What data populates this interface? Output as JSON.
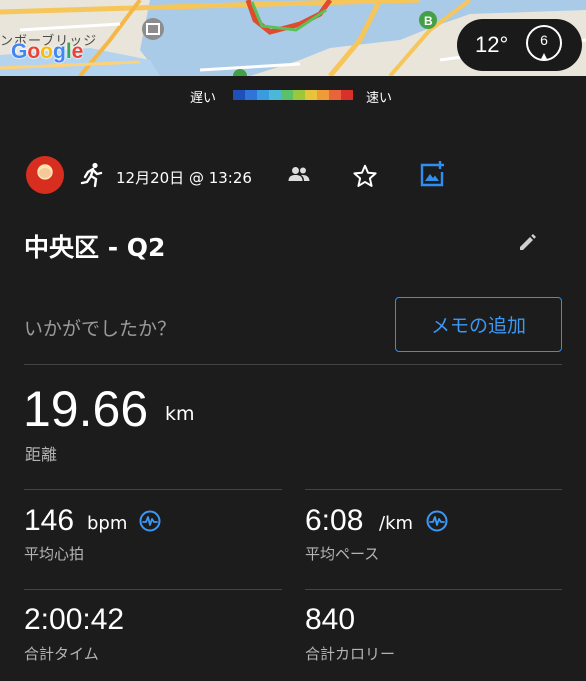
{
  "map": {
    "label": "ンボーブリッジ",
    "google_logo": [
      "G",
      "o",
      "o",
      "g",
      "l",
      "e"
    ],
    "google_colors": [
      "#4285F4",
      "#EA4335",
      "#FBBC05",
      "#4285F4",
      "#34A853",
      "#EA4335"
    ],
    "weather": {
      "temperature": "12°",
      "wind_speed": "6"
    }
  },
  "pace_legend": {
    "slow_label": "遅い",
    "fast_label": "速い",
    "colors": [
      "#1f4fb8",
      "#2f74d6",
      "#3a9be0",
      "#4cb8d8",
      "#5bc06a",
      "#9ac83a",
      "#e9c33a",
      "#f09a3a",
      "#e8643a",
      "#d9302a"
    ]
  },
  "activity": {
    "type_icon": "running-icon",
    "date": "12月20日 @ 13:26",
    "title": "中央区 - Q2"
  },
  "memo": {
    "prompt": "いかがでしたか？",
    "button_label": "メモの追加"
  },
  "stats": {
    "distance": {
      "value": "19.66",
      "unit": "km",
      "label": "距離"
    },
    "avg_hr": {
      "value": "146",
      "unit": "bpm",
      "label": "平均心拍"
    },
    "avg_pace": {
      "value": "6:08",
      "unit": "/km",
      "label": "平均ペース"
    },
    "total_time": {
      "value": "2:00:42",
      "label": "合計タイム"
    },
    "calories": {
      "value": "840",
      "label": "合計カロリー"
    }
  },
  "colors": {
    "background": "#1c1c1c",
    "accent": "#3b98f5",
    "label": "#b4b4b4",
    "divider": "#444444"
  }
}
